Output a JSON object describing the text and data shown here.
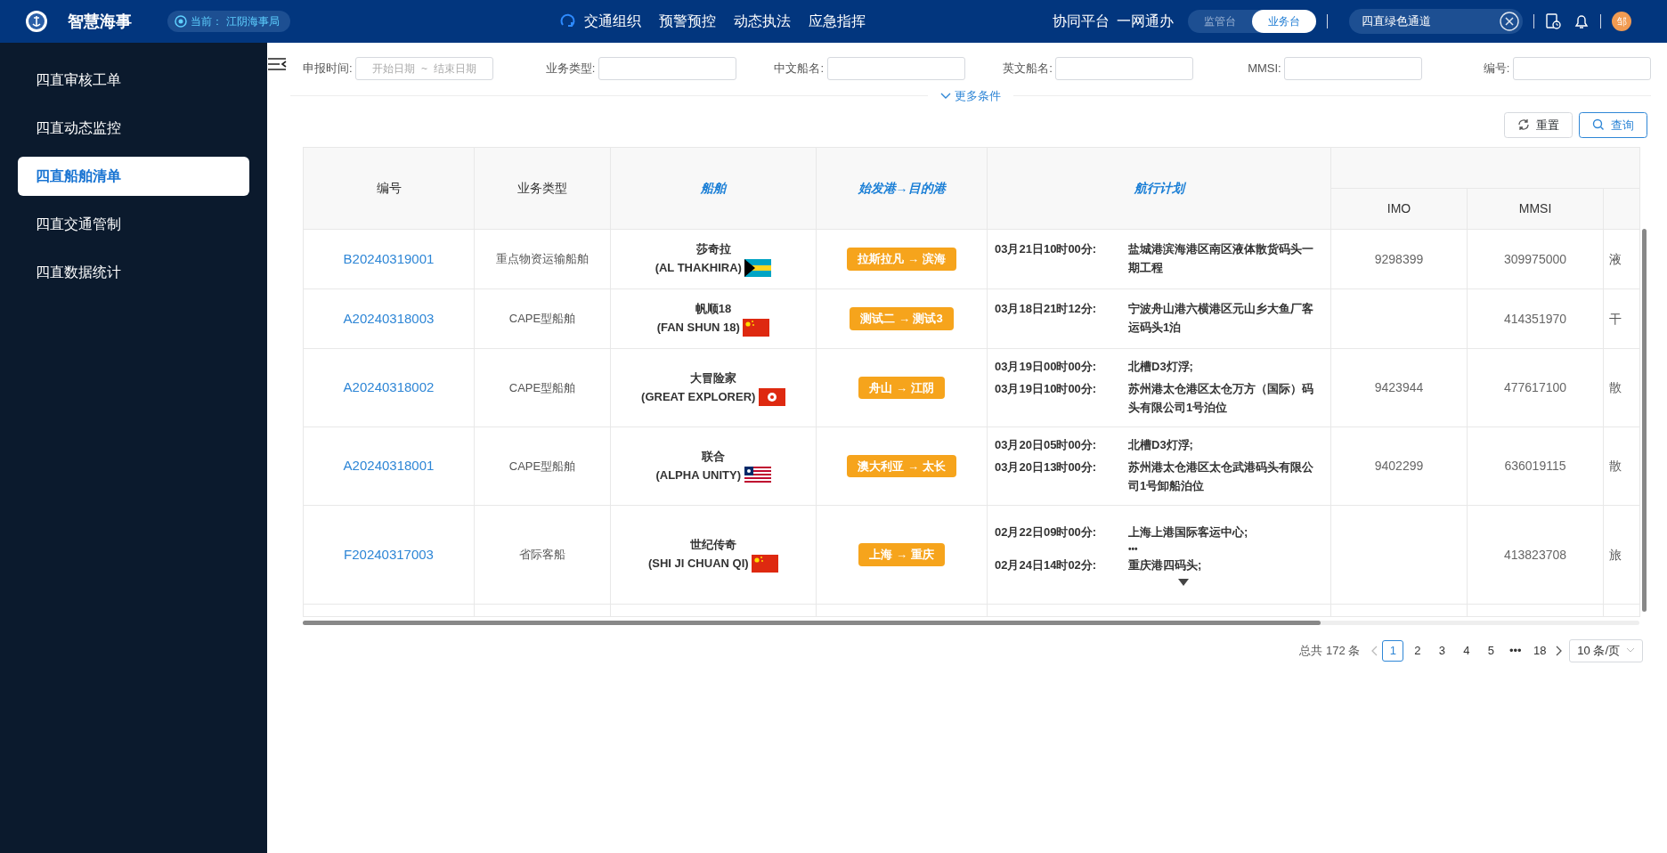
{
  "header": {
    "logo_text": "智慧海事",
    "location_label": "当前：",
    "location": "江阴海事局",
    "nav": [
      {
        "label": "交通组织"
      },
      {
        "label": "预警预控"
      },
      {
        "label": "动态执法"
      },
      {
        "label": "应急指挥"
      }
    ],
    "links": [
      "协同平台",
      "一网通办"
    ],
    "mode_tabs": [
      {
        "label": "监管台",
        "selected": false
      },
      {
        "label": "业务台",
        "selected": true
      }
    ],
    "search": {
      "value": "四直绿色通道"
    },
    "avatar": "邹"
  },
  "sidebar": {
    "items": [
      {
        "label": "四直审核工单",
        "selected": false
      },
      {
        "label": "四直动态监控",
        "selected": false
      },
      {
        "label": "四直船舶清单",
        "selected": true
      },
      {
        "label": "四直交通管制",
        "selected": false
      },
      {
        "label": "四直数据统计",
        "selected": false
      }
    ]
  },
  "filters": {
    "fields": [
      {
        "label": "申报时间:",
        "kind": "daterange",
        "start_placeholder": "开始日期",
        "separator": "~",
        "end_placeholder": "结束日期"
      },
      {
        "label": "业务类型:",
        "kind": "text"
      },
      {
        "label": "中文船名:",
        "kind": "text"
      },
      {
        "label": "英文船名:",
        "kind": "text"
      },
      {
        "label": "MMSI:",
        "kind": "text"
      },
      {
        "label": "编号:",
        "kind": "text"
      }
    ],
    "more": "更多条件",
    "reset": "重置",
    "query": "查询"
  },
  "table": {
    "columns": [
      {
        "label": "编号",
        "highlight": false
      },
      {
        "label": "业务类型",
        "highlight": false
      },
      {
        "label": "船舶",
        "highlight": true
      },
      {
        "label": "始发港→目的港",
        "highlight": true
      },
      {
        "label": "航行计划",
        "highlight": true
      }
    ],
    "group_columns": [
      "IMO",
      "MMSI"
    ],
    "rows": [
      {
        "id": "B20240319001",
        "type": "重点物资运输船舶",
        "ship_cn": "莎奇拉",
        "ship_en": "(AL THAKHIRA)",
        "flag": {
          "kind": "bahamas"
        },
        "route": "拉斯拉凡 → 滨海",
        "plan": {
          "stops": [
            {
              "time": "03月21日10时00分:",
              "place": "盐城港滨海港区南区液体散货码头一期工程"
            }
          ]
        },
        "imo": "9298399",
        "mmsi": "309975000",
        "column_8": "液"
      },
      {
        "id": "A20240318003",
        "type": "CAPE型船舶",
        "ship_cn": "帆顺18",
        "ship_en": "(FAN SHUN 18)",
        "flag": {
          "kind": "china"
        },
        "route": "测试二 → 测试3",
        "plan": {
          "stops": [
            {
              "time": "03月18日21时12分:",
              "place": "宁波舟山港六横港区元山乡大鱼厂客运码头1泊"
            }
          ]
        },
        "mmsi": "414351970",
        "column_8": "干"
      },
      {
        "id": "A20240318002",
        "type": "CAPE型船舶",
        "ship_cn": "大冒险家",
        "ship_en": "(GREAT EXPLORER)",
        "flag": {
          "kind": "hongkong"
        },
        "route": "舟山 → 江阴",
        "plan": {
          "stops": [
            {
              "time": "03月19日00时00分:",
              "place": "北槽D3灯浮;"
            },
            {
              "time": "03月19日10时00分:",
              "place": "苏州港太仓港区太仓万方（国际）码头有限公司1号泊位"
            }
          ]
        },
        "imo": "9423944",
        "mmsi": "477617100",
        "column_8": "散"
      },
      {
        "id": "A20240318001",
        "type": "CAPE型船舶",
        "ship_cn": "联合",
        "ship_en": "(ALPHA UNITY)",
        "flag": {
          "kind": "liberia"
        },
        "route": "澳大利亚 → 太长",
        "plan": {
          "stops": [
            {
              "time": "03月20日05时00分:",
              "place": "北槽D3灯浮;"
            },
            {
              "time": "03月20日13时00分:",
              "place": "苏州港太仓港区太仓武港码头有限公司1号卸船泊位"
            }
          ]
        },
        "imo": "9402299",
        "mmsi": "636019115",
        "column_8": "散"
      },
      {
        "id": "F20240317003",
        "type": "省际客船",
        "ship_cn": "世纪传奇",
        "ship_en": "(SHI JI CHUAN QI)",
        "flag": {
          "kind": "china"
        },
        "route": "上海 → 重庆",
        "plan": {
          "stops": [
            {
              "time": "02月22日09时00分:",
              "place": "上海上港国际客运中心;"
            },
            {
              "time": "02月24日14时02分:",
              "place": "重庆港四码头;"
            }
          ],
          "omitted": "•••",
          "collapsed": true
        },
        "mmsi": "413823708",
        "column_8": "旅"
      }
    ]
  },
  "pagination": {
    "total": "总共 172 条",
    "pages": [
      {
        "label": "1",
        "selected": true
      },
      {
        "label": "2",
        "selected": false
      },
      {
        "label": "3",
        "selected": false
      },
      {
        "label": "4",
        "selected": false
      },
      {
        "label": "5",
        "selected": false
      },
      {
        "label": "•••",
        "selected": false
      },
      {
        "label": "18",
        "selected": false
      }
    ],
    "page_size": "10 条/页"
  }
}
